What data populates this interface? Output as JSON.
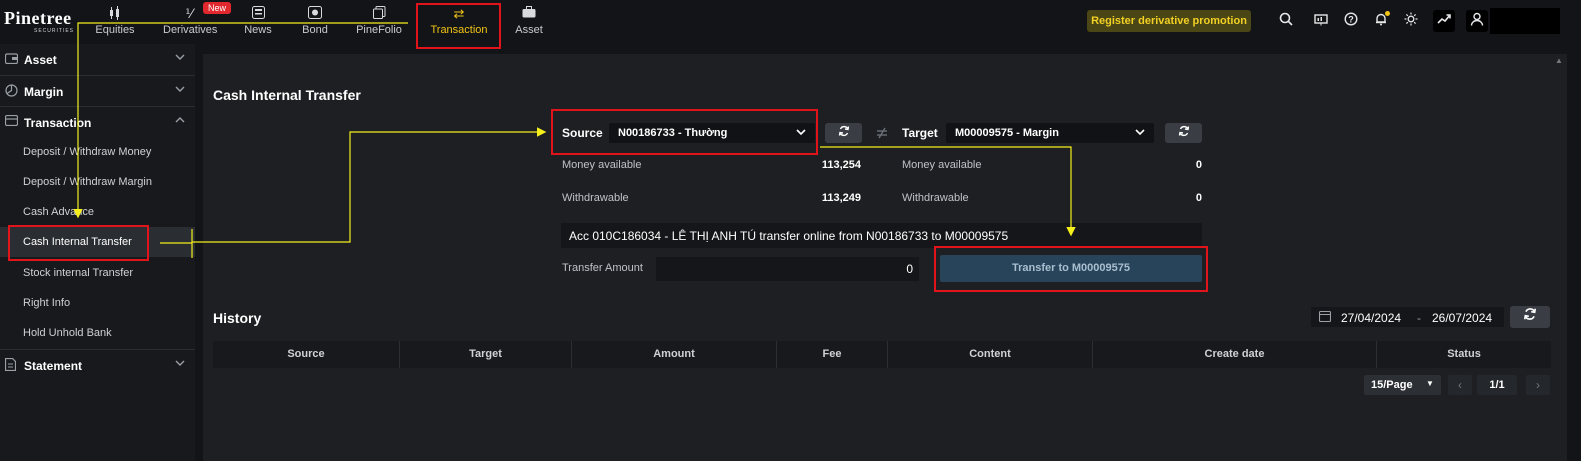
{
  "brand": {
    "name": "Pinetree",
    "sub": "SECURITIES"
  },
  "nav": {
    "items": [
      {
        "label": "Equities",
        "icon": "candlestick-icon"
      },
      {
        "label": "Derivatives",
        "icon": "percent-icon",
        "badge": "New"
      },
      {
        "label": "News",
        "icon": "news-icon"
      },
      {
        "label": "Bond",
        "icon": "bond-icon"
      },
      {
        "label": "PineFolio",
        "icon": "folio-icon"
      },
      {
        "label": "Transaction",
        "icon": "transfer-icon",
        "active": true
      },
      {
        "label": "Asset",
        "icon": "briefcase-icon"
      }
    ],
    "promo": "Register derivative promotion"
  },
  "sidebar": {
    "sections": [
      {
        "label": "Asset",
        "icon": "wallet-icon",
        "expanded": false
      },
      {
        "label": "Margin",
        "icon": "margin-icon",
        "expanded": false
      },
      {
        "label": "Transaction",
        "icon": "card-icon",
        "expanded": true,
        "items": [
          "Deposit / Withdraw Money",
          "Deposit / Withdraw Margin",
          "Cash Advance",
          "Cash Internal Transfer",
          "Stock internal Transfer",
          "Right Info",
          "Hold Unhold Bank"
        ],
        "active_item": "Cash Internal Transfer"
      },
      {
        "label": "Statement",
        "icon": "document-icon",
        "expanded": false
      }
    ]
  },
  "transfer": {
    "title": "Cash Internal Transfer",
    "source_label": "Source",
    "source_value": "N00186733 - Thường",
    "target_label": "Target",
    "target_value": "M00009575 - Margin",
    "src_money_label": "Money available",
    "src_money_value": "113,254",
    "src_withdraw_label": "Withdrawable",
    "src_withdraw_value": "113,249",
    "tgt_money_label": "Money available",
    "tgt_money_value": "0",
    "tgt_withdraw_label": "Withdrawable",
    "tgt_withdraw_value": "0",
    "content": "Acc 010C186034 - LÊ THỊ ANH TÚ transfer online from N00186733 to M00009575",
    "amount_label": "Transfer Amount",
    "amount_value": "0",
    "submit_label": "Transfer to M00009575"
  },
  "history": {
    "title": "History",
    "date_from": "27/04/2024",
    "date_sep": "-",
    "date_to": "26/07/2024",
    "columns": [
      "Source",
      "Target",
      "Amount",
      "Fee",
      "Content",
      "Create date",
      "Status"
    ],
    "page_size": "15/Page",
    "page": "1/1"
  },
  "colors": {
    "accent": "#f2c417",
    "annotation_red": "#e2141b",
    "annotation_yellow": "#f5ef1c"
  }
}
